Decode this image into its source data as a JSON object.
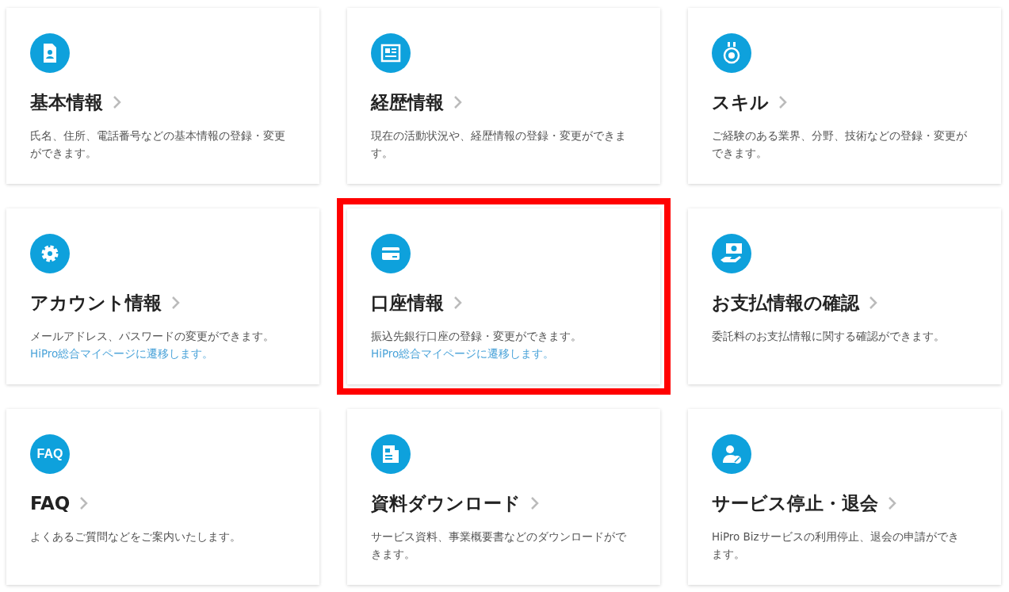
{
  "cards": [
    {
      "kind": "profile",
      "title": "基本情報",
      "description": "氏名、住所、電話番号などの基本情報の登録・変更ができます。",
      "highlighted": false
    },
    {
      "kind": "resume",
      "title": "経歴情報",
      "description": "現在の活動状況や、経歴情報の登録・変更ができます。",
      "highlighted": false
    },
    {
      "kind": "medal",
      "title": "スキル",
      "description": "ご経験のある業界、分野、技術などの登録・変更ができます。",
      "highlighted": false
    },
    {
      "kind": "gear",
      "title": "アカウント情報",
      "description": "メールアドレス、パスワードの変更ができます。",
      "link": "HiPro総合マイページに遷移します。",
      "highlighted": false
    },
    {
      "kind": "card",
      "title": "口座情報",
      "description": "振込先銀行口座の登録・変更ができます。",
      "link": "HiPro総合マイページに遷移します。",
      "highlighted": true
    },
    {
      "kind": "money",
      "title": "お支払情報の確認",
      "description": "委託料のお支払情報に関する確認ができます。",
      "highlighted": false
    },
    {
      "kind": "faq",
      "icon_text": "FAQ",
      "title": "FAQ",
      "description": "よくあるご質問などをご案内いたします。",
      "highlighted": false
    },
    {
      "kind": "document",
      "title": "資料ダウンロード",
      "description": "サービス資料、事業概要書などのダウンロードができます。",
      "highlighted": false
    },
    {
      "kind": "user-block",
      "title": "サービス停止・退会",
      "description": "HiPro Bizサービスの利用停止、退会の申請ができます。",
      "highlighted": false
    }
  ]
}
